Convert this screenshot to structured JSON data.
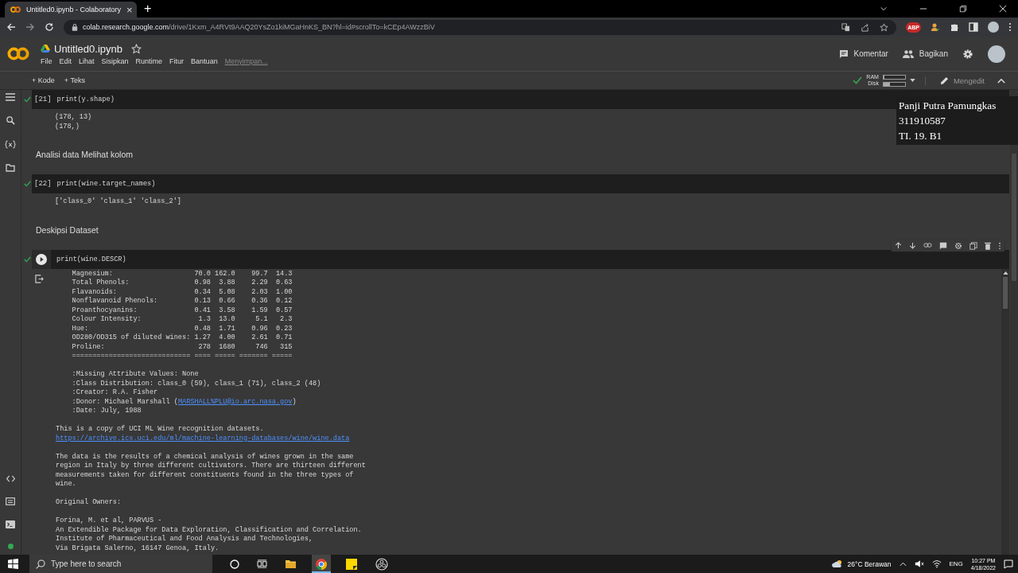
{
  "browser": {
    "tab": {
      "title": "Untitled0.ipynb - Colaboratory",
      "close": "×"
    },
    "new_tab": "+",
    "url": {
      "host": "colab.research.google.com",
      "path": "/drive/1Kxm_A4RVt9AAQ20YsZo1kiMGaHnKS_BN?hl=id#scrollTo=kCEp4AWzzBiV"
    },
    "extension_badge": "ABP"
  },
  "header": {
    "title": "Untitled0.ipynb",
    "menu": [
      "File",
      "Edit",
      "Lihat",
      "Sisipkan",
      "Runtime",
      "Fitur",
      "Bantuan"
    ],
    "save_status": "Menyimpan...",
    "actions": [
      {
        "kind": "comment",
        "label": "Komentar"
      },
      {
        "kind": "share",
        "label": "Bagikan"
      }
    ]
  },
  "toolbar": {
    "add_buttons": [
      "+ Kode",
      "+ Teks"
    ],
    "connected": true,
    "resources": [
      {
        "label": "RAM",
        "level": 0.05
      },
      {
        "label": "Disk",
        "level": 0.3
      }
    ],
    "mode": "Mengedit"
  },
  "cells": [
    {
      "kind": "code",
      "count": "[21]",
      "run_button": false,
      "done": true,
      "code": "print(y.shape)",
      "output": [
        {
          "kind": "text",
          "text": "(178, 13)"
        },
        {
          "kind": "text",
          "text": "(178,)"
        }
      ]
    },
    {
      "kind": "markdown",
      "text": "Analisi data Melihat kolom"
    },
    {
      "kind": "code",
      "count": "[22]",
      "run_button": false,
      "done": true,
      "code": "print(wine.target_names)",
      "output": [
        {
          "kind": "text",
          "text": "['class_0' 'class_1' 'class_2']"
        }
      ]
    },
    {
      "kind": "markdown",
      "text": "Deskipsi Dataset"
    },
    {
      "kind": "code",
      "run_button": true,
      "done": true,
      "code": "print(wine.DESCR)",
      "scrolled": true,
      "output": [
        {
          "kind": "text",
          "text": "    Magnesium:                    70.0 162.0    99.7  14.3"
        },
        {
          "kind": "text",
          "text": "    Total Phenols:                0.98  3.88    2.29  0.63"
        },
        {
          "kind": "text",
          "text": "    Flavanoids:                   0.34  5.08    2.03  1.00"
        },
        {
          "kind": "text",
          "text": "    Nonflavanoid Phenols:         0.13  0.66    0.36  0.12"
        },
        {
          "kind": "text",
          "text": "    Proanthocyanins:              0.41  3.58    1.59  0.57"
        },
        {
          "kind": "text",
          "text": "    Colour Intensity:              1.3  13.0     5.1   2.3"
        },
        {
          "kind": "text",
          "text": "    Hue:                          0.48  1.71    0.96  0.23"
        },
        {
          "kind": "text",
          "text": "    OD280/OD315 of diluted wines: 1.27  4.00    2.61  0.71"
        },
        {
          "kind": "text",
          "text": "    Proline:                       278  1680     746   315"
        },
        {
          "kind": "text",
          "text": "    ============================= ==== ===== ======= ====="
        },
        {
          "kind": "gap"
        },
        {
          "kind": "text",
          "text": "    :Missing Attribute Values: None"
        },
        {
          "kind": "text",
          "text": "    :Class Distribution: class_0 (59), class_1 (71), class_2 (48)"
        },
        {
          "kind": "text",
          "text": "    :Creator: R.A. Fisher"
        },
        {
          "kind": "mixed",
          "before": "    :Donor: Michael Marshall (",
          "link": "MARSHALL%PLU@io.arc.nasa.gov",
          "after": ")"
        },
        {
          "kind": "text",
          "text": "    :Date: July, 1988"
        },
        {
          "kind": "gap"
        },
        {
          "kind": "text",
          "text": "This is a copy of UCI ML Wine recognition datasets."
        },
        {
          "kind": "link",
          "text": "https://archive.ics.uci.edu/ml/machine-learning-databases/wine/wine.data"
        },
        {
          "kind": "gap"
        },
        {
          "kind": "text",
          "text": "The data is the results of a chemical analysis of wines grown in the same\nregion in Italy by three different cultivators. There are thirteen different\nmeasurements taken for different constituents found in the three types of\nwine."
        },
        {
          "kind": "gap"
        },
        {
          "kind": "text",
          "text": "Original Owners:"
        },
        {
          "kind": "gap"
        },
        {
          "kind": "text",
          "text": "Forina, M. et al, PARVUS -\nAn Extendible Package for Data Exploration, Classification and Correlation.\nInstitute of Pharmaceutical and Food Analysis and Technologies,\nVia Brigata Salerno, 16147 Genoa, Italy."
        }
      ]
    }
  ],
  "overlay": {
    "lines": [
      "Panji Putra Pamungkas",
      "311910587",
      "TI. 19. B1"
    ]
  },
  "taskbar": {
    "search_placeholder": "Type here to search",
    "apps": [
      {
        "kind": "explorer",
        "selected": false
      },
      {
        "kind": "chrome",
        "selected": true
      },
      {
        "kind": "sticky",
        "selected": false
      },
      {
        "kind": "obs",
        "selected": false
      }
    ],
    "weather": "26°C Berawan",
    "language": "ENG",
    "time": "10:27 PM",
    "date": "4/18/2022"
  }
}
